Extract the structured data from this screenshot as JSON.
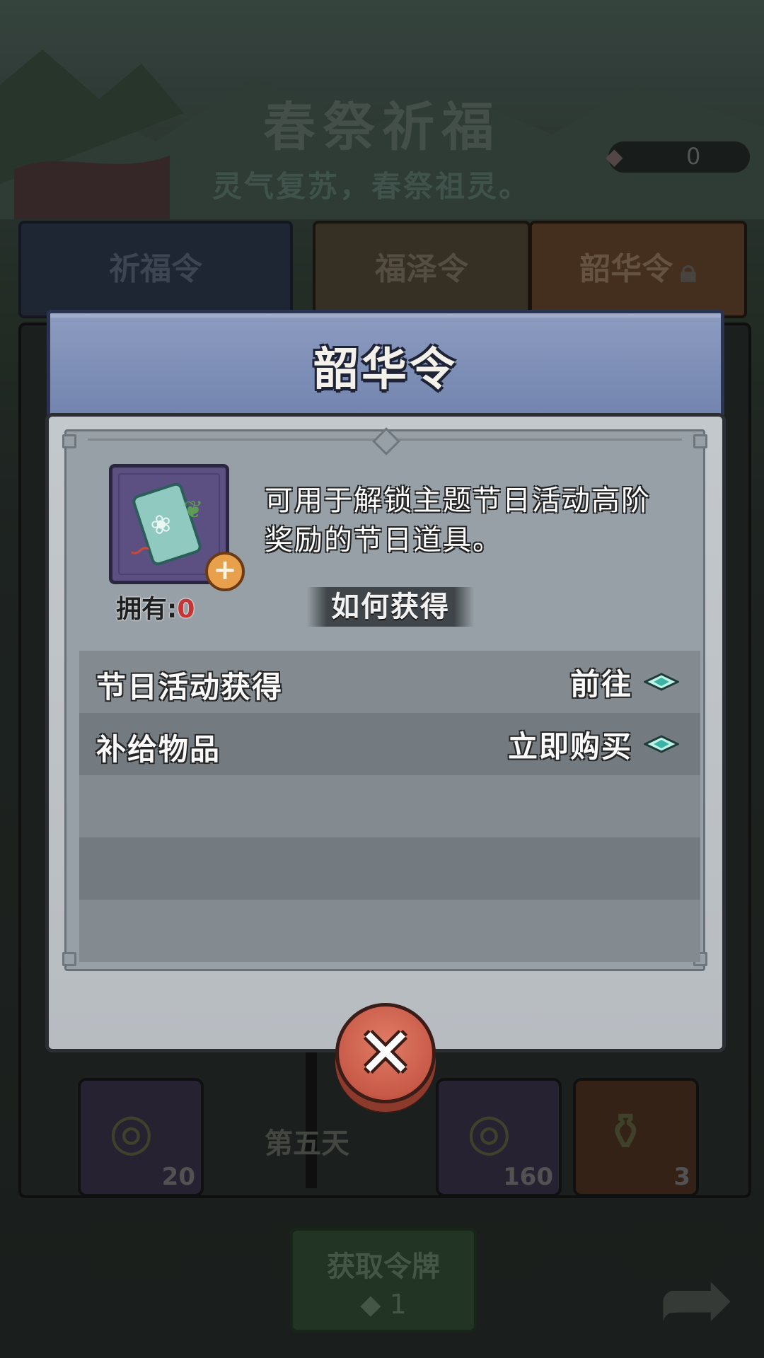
{
  "background": {
    "title": "春祭祈福",
    "subtitle": "灵气复苏，春祭祖灵。",
    "currency_value": "0",
    "tabs": [
      {
        "label": "祈福令"
      },
      {
        "label": "福泽令"
      },
      {
        "label": "韶华令",
        "locked": true
      }
    ],
    "day_label": "第五天",
    "reward_counts": [
      "20",
      "160",
      "3"
    ],
    "get_button": {
      "label": "获取令牌",
      "count": "1"
    }
  },
  "dialog": {
    "title": "韶华令",
    "description": "可用于解锁主题节日活动高阶奖励的节日道具。",
    "owned_label": "拥有:",
    "owned_value": "0",
    "how_to_get": "如何获得",
    "sources": [
      {
        "label": "节日活动获得",
        "action": "前往",
        "icon": "diamond-arrow-icon"
      },
      {
        "label": "补给物品",
        "action": "立即购买",
        "icon": "diamond-arrow-icon"
      }
    ],
    "colors": {
      "header": "#7f8fb8",
      "body": "#bcc1c6",
      "list_light": "#838a90",
      "list_dark": "#737a80",
      "close": "#d06a55",
      "owned_value": "#c43636"
    }
  }
}
